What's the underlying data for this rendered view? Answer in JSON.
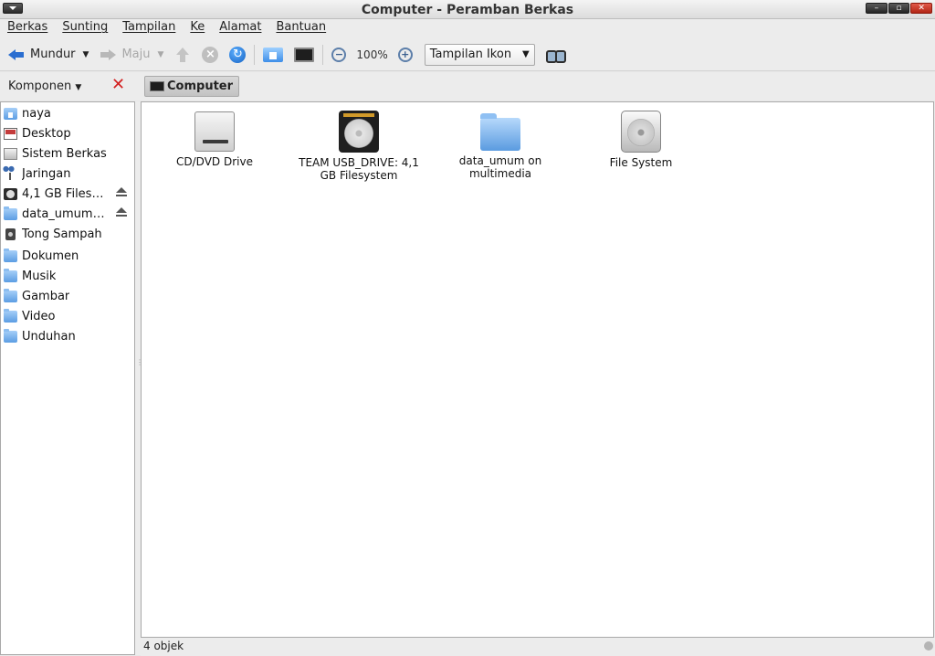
{
  "window": {
    "title": "Computer - Peramban Berkas",
    "controls": [
      "minimize",
      "maximize",
      "close"
    ]
  },
  "menubar": {
    "items": [
      "Berkas",
      "Sunting",
      "Tampilan",
      "Ke",
      "Alamat",
      "Bantuan"
    ]
  },
  "toolbar": {
    "back_label": "Mundur",
    "forward_label": "Maju",
    "zoom_level": "100%",
    "view_mode": "Tampilan Ikon",
    "icons": [
      "back-arrow-icon",
      "forward-arrow-icon",
      "up-arrow-icon",
      "stop-icon",
      "reload-icon",
      "home-icon",
      "computer-icon",
      "zoom-out-icon",
      "zoom-in-icon",
      "search-binoculars-icon"
    ]
  },
  "sidebar": {
    "title": "Komponen",
    "items": [
      {
        "label": "naya",
        "icon": "home-folder-icon"
      },
      {
        "label": "Desktop",
        "icon": "desktop-icon"
      },
      {
        "label": "Sistem Berkas",
        "icon": "filesystem-icon"
      },
      {
        "label": "Jaringan",
        "icon": "network-icon"
      },
      {
        "label": "4,1 GB Filesystem",
        "icon": "hard-drive-icon",
        "eject": true
      },
      {
        "label": "data_umum on multimedia",
        "icon": "folder-icon",
        "eject": true
      },
      {
        "label": "Tong Sampah",
        "icon": "trash-icon"
      },
      {
        "label": "Dokumen",
        "icon": "folder-icon"
      },
      {
        "label": "Musik",
        "icon": "folder-icon"
      },
      {
        "label": "Gambar",
        "icon": "folder-icon"
      },
      {
        "label": "Video",
        "icon": "folder-icon"
      },
      {
        "label": "Unduhan",
        "icon": "folder-icon"
      }
    ]
  },
  "location": {
    "crumb": "Computer"
  },
  "main": {
    "items": [
      {
        "label": "CD/DVD Drive",
        "icon": "cd-drive-icon"
      },
      {
        "label": "TEAM USB_DRIVE: 4,1 GB Filesystem",
        "icon": "usb-hard-drive-icon"
      },
      {
        "label": "data_umum on multimedia",
        "icon": "network-folder-icon"
      },
      {
        "label": "File System",
        "icon": "filesystem-drive-icon"
      }
    ]
  },
  "status": {
    "text": "4 objek"
  },
  "colors": {
    "accent": "#2a6ed0",
    "close_red": "#d32020"
  }
}
